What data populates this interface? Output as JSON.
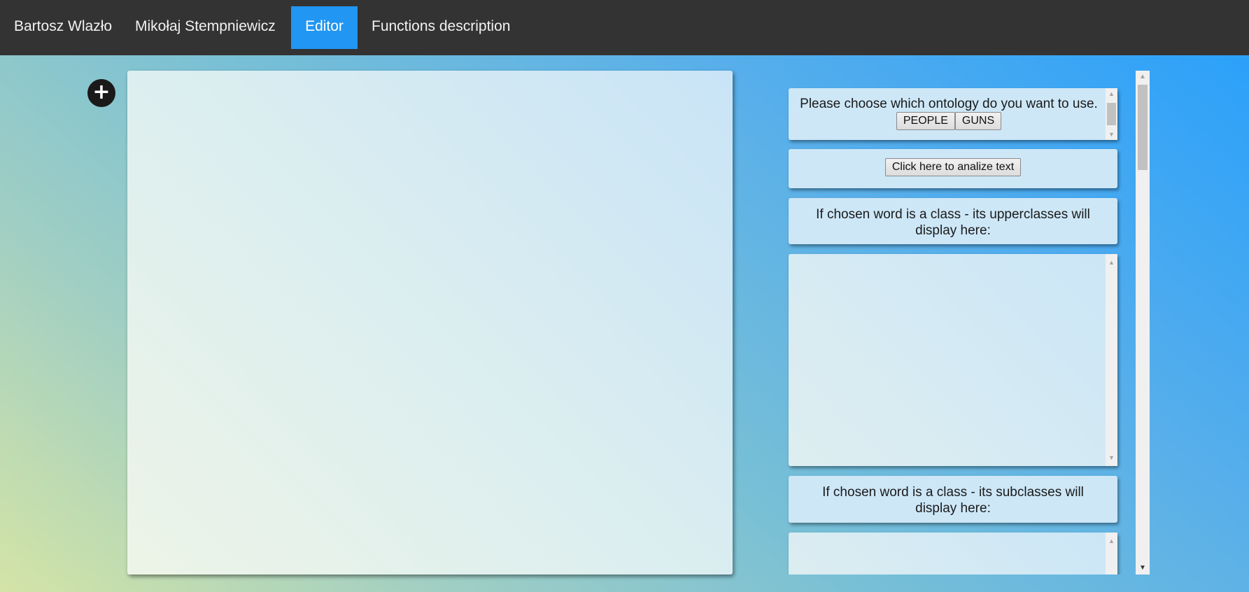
{
  "nav": {
    "items": [
      {
        "label": "Bartosz Wlazło"
      },
      {
        "label": "Mikołaj Stempniewicz"
      },
      {
        "label": "Editor",
        "active": true
      },
      {
        "label": "Functions description"
      }
    ]
  },
  "editor": {
    "add_button": "+",
    "text": ""
  },
  "panel": {
    "ontology": {
      "prompt": "Please choose which ontology do you want to use.",
      "buttons": [
        "PEOPLE",
        "GUNS"
      ]
    },
    "analyze_button": "Click here to analize text",
    "upperclasses_label": "If chosen word is a class - its upperclasses will display here:",
    "subclasses_label": "If chosen word is a class - its subclasses will display here:"
  },
  "icons": {
    "add": "plus-icon",
    "scroll_up": "arrow-up-icon",
    "scroll_down": "arrow-down-icon"
  },
  "colors": {
    "nav_bg": "#333333",
    "nav_active": "#2196f3",
    "panel_box": "#cde7f7"
  }
}
